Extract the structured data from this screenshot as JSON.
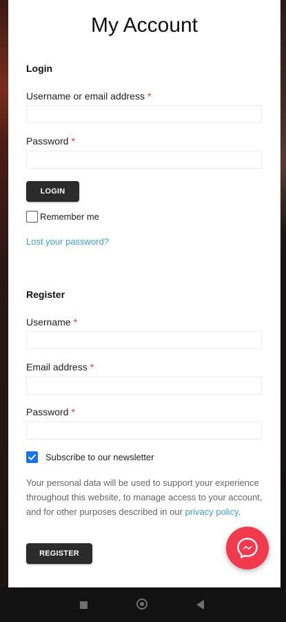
{
  "page": {
    "title": "My Account"
  },
  "login": {
    "heading": "Login",
    "username_label": "Username or email address",
    "password_label": "Password",
    "required_mark": "*",
    "button_label": "LOGIN",
    "remember_label": "Remember me",
    "remember_checked": false,
    "lost_password_link": "Lost your password?"
  },
  "register": {
    "heading": "Register",
    "username_label": "Username",
    "email_label": "Email address",
    "password_label": "Password",
    "required_mark": "*",
    "subscribe_label": "Subscribe to our newsletter",
    "subscribe_checked": true,
    "privacy_text_before": "Your personal data will be used to support your experience throughout this website, to manage access to your account, and for other purposes described in our",
    "privacy_link": "privacy policy",
    "privacy_text_after": ".",
    "button_label": "REGISTER"
  },
  "fab": {
    "icon": "messenger-icon",
    "color": "#f23a4e"
  },
  "android_nav": {
    "icons": [
      "recent-apps-icon",
      "home-icon",
      "back-icon"
    ]
  },
  "colors": {
    "accent_link": "#3aa1c9",
    "required": "#e2401c",
    "button": "#2b2b2b",
    "checkbox": "#1a73e8"
  }
}
